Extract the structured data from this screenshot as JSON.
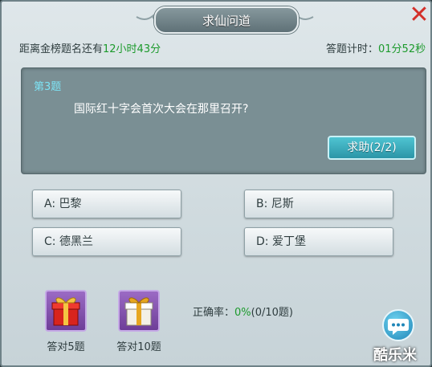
{
  "header": {
    "title": "求仙问道",
    "close_icon": "close-icon",
    "countdown_label": "距离金榜题名还有",
    "countdown_value": "12小时43分",
    "timer_label": "答题计时：",
    "timer_value": "01分52秒"
  },
  "question": {
    "number": "第3题",
    "text": "国际红十字会首次大会在那里召开?",
    "help_label": "求助(2/2)"
  },
  "answers": [
    {
      "label": "A:  巴黎"
    },
    {
      "label": "B:  尼斯"
    },
    {
      "label": "C:  德黑兰"
    },
    {
      "label": "D:  爱丁堡"
    }
  ],
  "rewards": [
    {
      "label": "答对5题",
      "icon": "red-gift-box-icon"
    },
    {
      "label": "答对10题",
      "icon": "white-gift-box-icon"
    }
  ],
  "accuracy": {
    "label": "正确率：",
    "value": "0%",
    "detail": "(0/10题)"
  },
  "chat": {
    "icon": "chat-bubble-icon"
  },
  "watermark": "酷乐米",
  "colors": {
    "accent_green": "#1c9a2c",
    "question_number": "#7de3f4",
    "help_button": "#2b95a7",
    "close_red": "#d3302a"
  }
}
